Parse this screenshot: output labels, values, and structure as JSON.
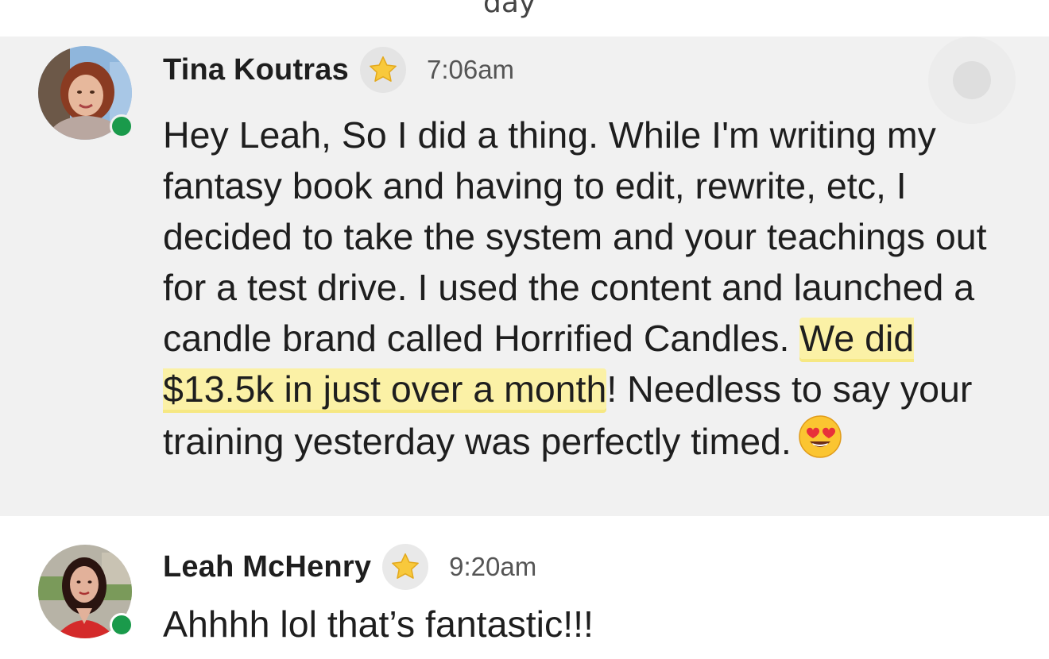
{
  "top_cutoff_text": "day",
  "messages": [
    {
      "author": "Tina Koutras",
      "badge_icon": "star-icon",
      "time": "7:06am",
      "online": true,
      "text_before": "Hey Leah, So I did a thing. While I'm writing my fantasy book and having to edit, rewrite, etc, I decided to take the system and your teachings out for a test drive. I used the content and launched a candle brand called Horrified Candles. ",
      "text_highlight": "We did $13.5k in just over a month",
      "text_after": "! Needless to say your training yesterday was perfectly timed.",
      "emoji": "heart-eyes-emoji"
    },
    {
      "author": "Leah McHenry",
      "badge_icon": "star-icon",
      "time": "9:20am",
      "online": true,
      "text": "Ahhhh lol that’s fantastic!!!"
    }
  ],
  "colors": {
    "highlight_bg": "#f1f1f1",
    "online": "#1a9a4b",
    "marker": "#fbf1a6"
  }
}
